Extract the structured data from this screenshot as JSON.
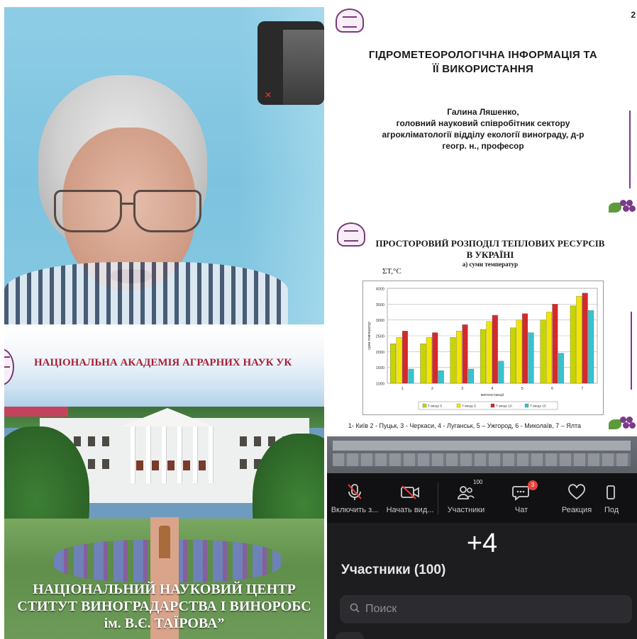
{
  "slide1": {
    "number": "2",
    "title_line1": "ГІДРОМЕТЕОРОЛОГІЧНА ІНФОРМАЦІЯ ТА",
    "title_line2": "ЇЇ ВИКОРИСТАННЯ",
    "author_line1": "Галина Ляшенко,",
    "author_line2": "головний науковий співробітник сектору",
    "author_line3": "агрокліматології відділу екології винограду, д-р",
    "author_line4": "геогр. н., професор"
  },
  "slide2": {
    "title_line1": "ПРОСТОРОВИЙ РОЗПОДІЛ ТЕПЛОВИХ РЕСУРСІВ",
    "title_line2": "В УКРАЇНІ",
    "subtitle": "а) суми температур",
    "unit": "ΣT,°C",
    "footnote": "1- Київ 2 - Пуцьк, 3 - Черкаси, 4 - Луганськ, 5 – Ужгород, 6 - Миколаїв, 7 – Ялта"
  },
  "chart_data": {
    "type": "bar",
    "title": "",
    "xlabel": "метеостанції",
    "ylabel": "суми температур",
    "ylim": [
      1000,
      4000
    ],
    "yticks": [
      1000,
      1500,
      2000,
      2500,
      3000,
      3500,
      4000
    ],
    "categories": [
      "1",
      "2",
      "3",
      "4",
      "5",
      "6",
      "7"
    ],
    "series": [
      {
        "name": "Т вище 5",
        "color": "#c8d400",
        "values": [
          2250,
          2250,
          2450,
          2700,
          2750,
          3000,
          3450
        ]
      },
      {
        "name": "Т вище 5",
        "color": "#f2e600",
        "values": [
          2450,
          2450,
          2650,
          2950,
          3000,
          3250,
          3750
        ]
      },
      {
        "name": "Т вище 10",
        "color": "#d32a2a",
        "values": [
          2650,
          2600,
          2850,
          3150,
          3200,
          3500,
          3850
        ]
      },
      {
        "name": "Т вище 15",
        "color": "#37c3cf",
        "values": [
          1450,
          1400,
          1450,
          1700,
          2600,
          1950,
          3300
        ]
      }
    ],
    "legend": "bottom"
  },
  "photo": {
    "academy": "НАЦІОНАЛЬНА АКАДЕМІЯ АГРАРНИХ НАУК УК",
    "caption_line1": "НАЦІОНАЛЬНИЙ НАУКОВИЙ ЦЕНТР",
    "caption_line2": "СТИТУТ ВИНОГРАДАРСТВА І ВИНОРОБС",
    "caption_line3": "ім. В.Є. ТАЇРОВА”"
  },
  "zoom": {
    "toolbar": [
      {
        "label": "Включить з...",
        "icon": "mic-off-icon"
      },
      {
        "label": "Начать вид...",
        "icon": "video-off-icon"
      },
      {
        "label": "Участники",
        "icon": "participants-icon",
        "badge": "100"
      },
      {
        "label": "Чат",
        "icon": "chat-icon",
        "badge": "3"
      },
      {
        "label": "Реакция",
        "icon": "heart-icon"
      },
      {
        "label": "Под",
        "icon": "more-icon"
      }
    ],
    "plus_count": "+4",
    "participants_title": "Участники (100)",
    "search_placeholder": "Поиск"
  },
  "colors": {
    "zoom_bg": "#1d1d1f",
    "slide_accent": "#7c3b8a",
    "academy_red": "#a4213a",
    "badge_red": "#e8413b"
  }
}
